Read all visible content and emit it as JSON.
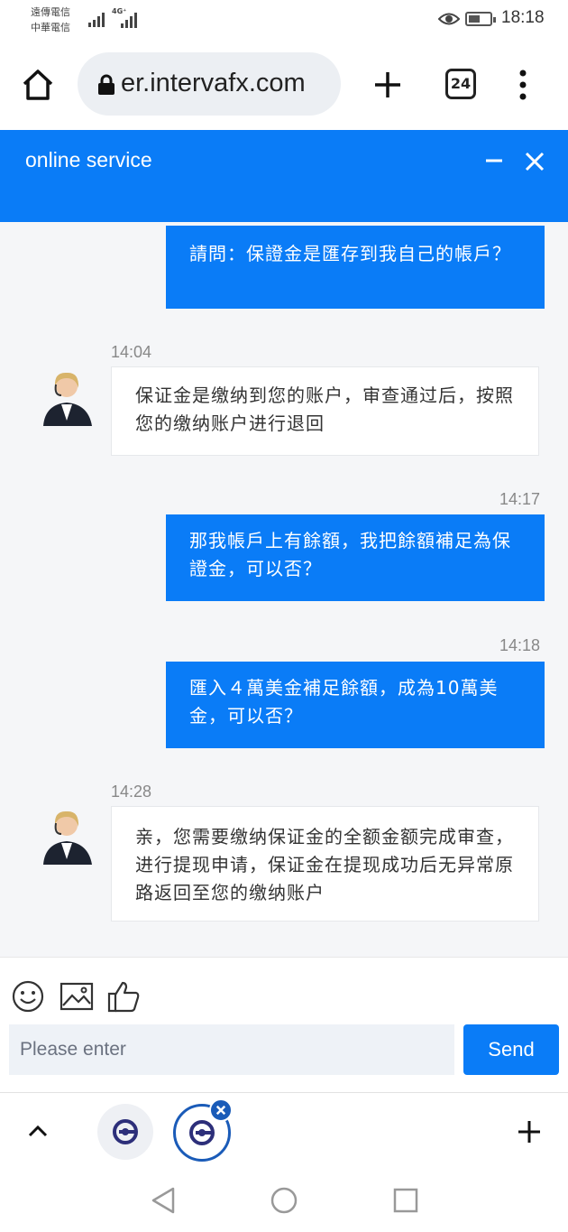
{
  "status_bar": {
    "carrier_1": "遠傳電信",
    "carrier_2": "中華電信",
    "network": "4G⁺",
    "time": "18:18",
    "battery_percent": 55
  },
  "browser": {
    "url": "er.intervafx.com",
    "tab_count": "24"
  },
  "chat": {
    "title": "online service",
    "messages": [
      {
        "side": "out",
        "text": "請問：保證金是匯存到我自己的帳戶？"
      },
      {
        "time": "14:04",
        "side": "in",
        "text": "保证金是缴纳到您的账户，审查通过后，按照您的缴纳账户进行退回"
      },
      {
        "time": "14:17",
        "side": "out",
        "text": "那我帳戶上有餘額，我把餘額補足為保證金，可以否？"
      },
      {
        "time": "14:18",
        "side": "out",
        "text": "匯入４萬美金補足餘額，成為10萬美金，可以否？"
      },
      {
        "time": "14:28",
        "side": "in",
        "text": "亲，您需要缴纳保证金的全额金额完成审查，进行提现申请，保证金在提现成功后无异常原路返回至您的缴纳账户"
      }
    ]
  },
  "input": {
    "placeholder": "Please enter",
    "send_label": "Send"
  },
  "icons": {
    "emoji": "smiley-icon",
    "image": "image-icon",
    "like": "thumbs-up-icon"
  },
  "colors": {
    "accent": "#0a7cf7",
    "tab_ring": "#1a5bb8"
  }
}
